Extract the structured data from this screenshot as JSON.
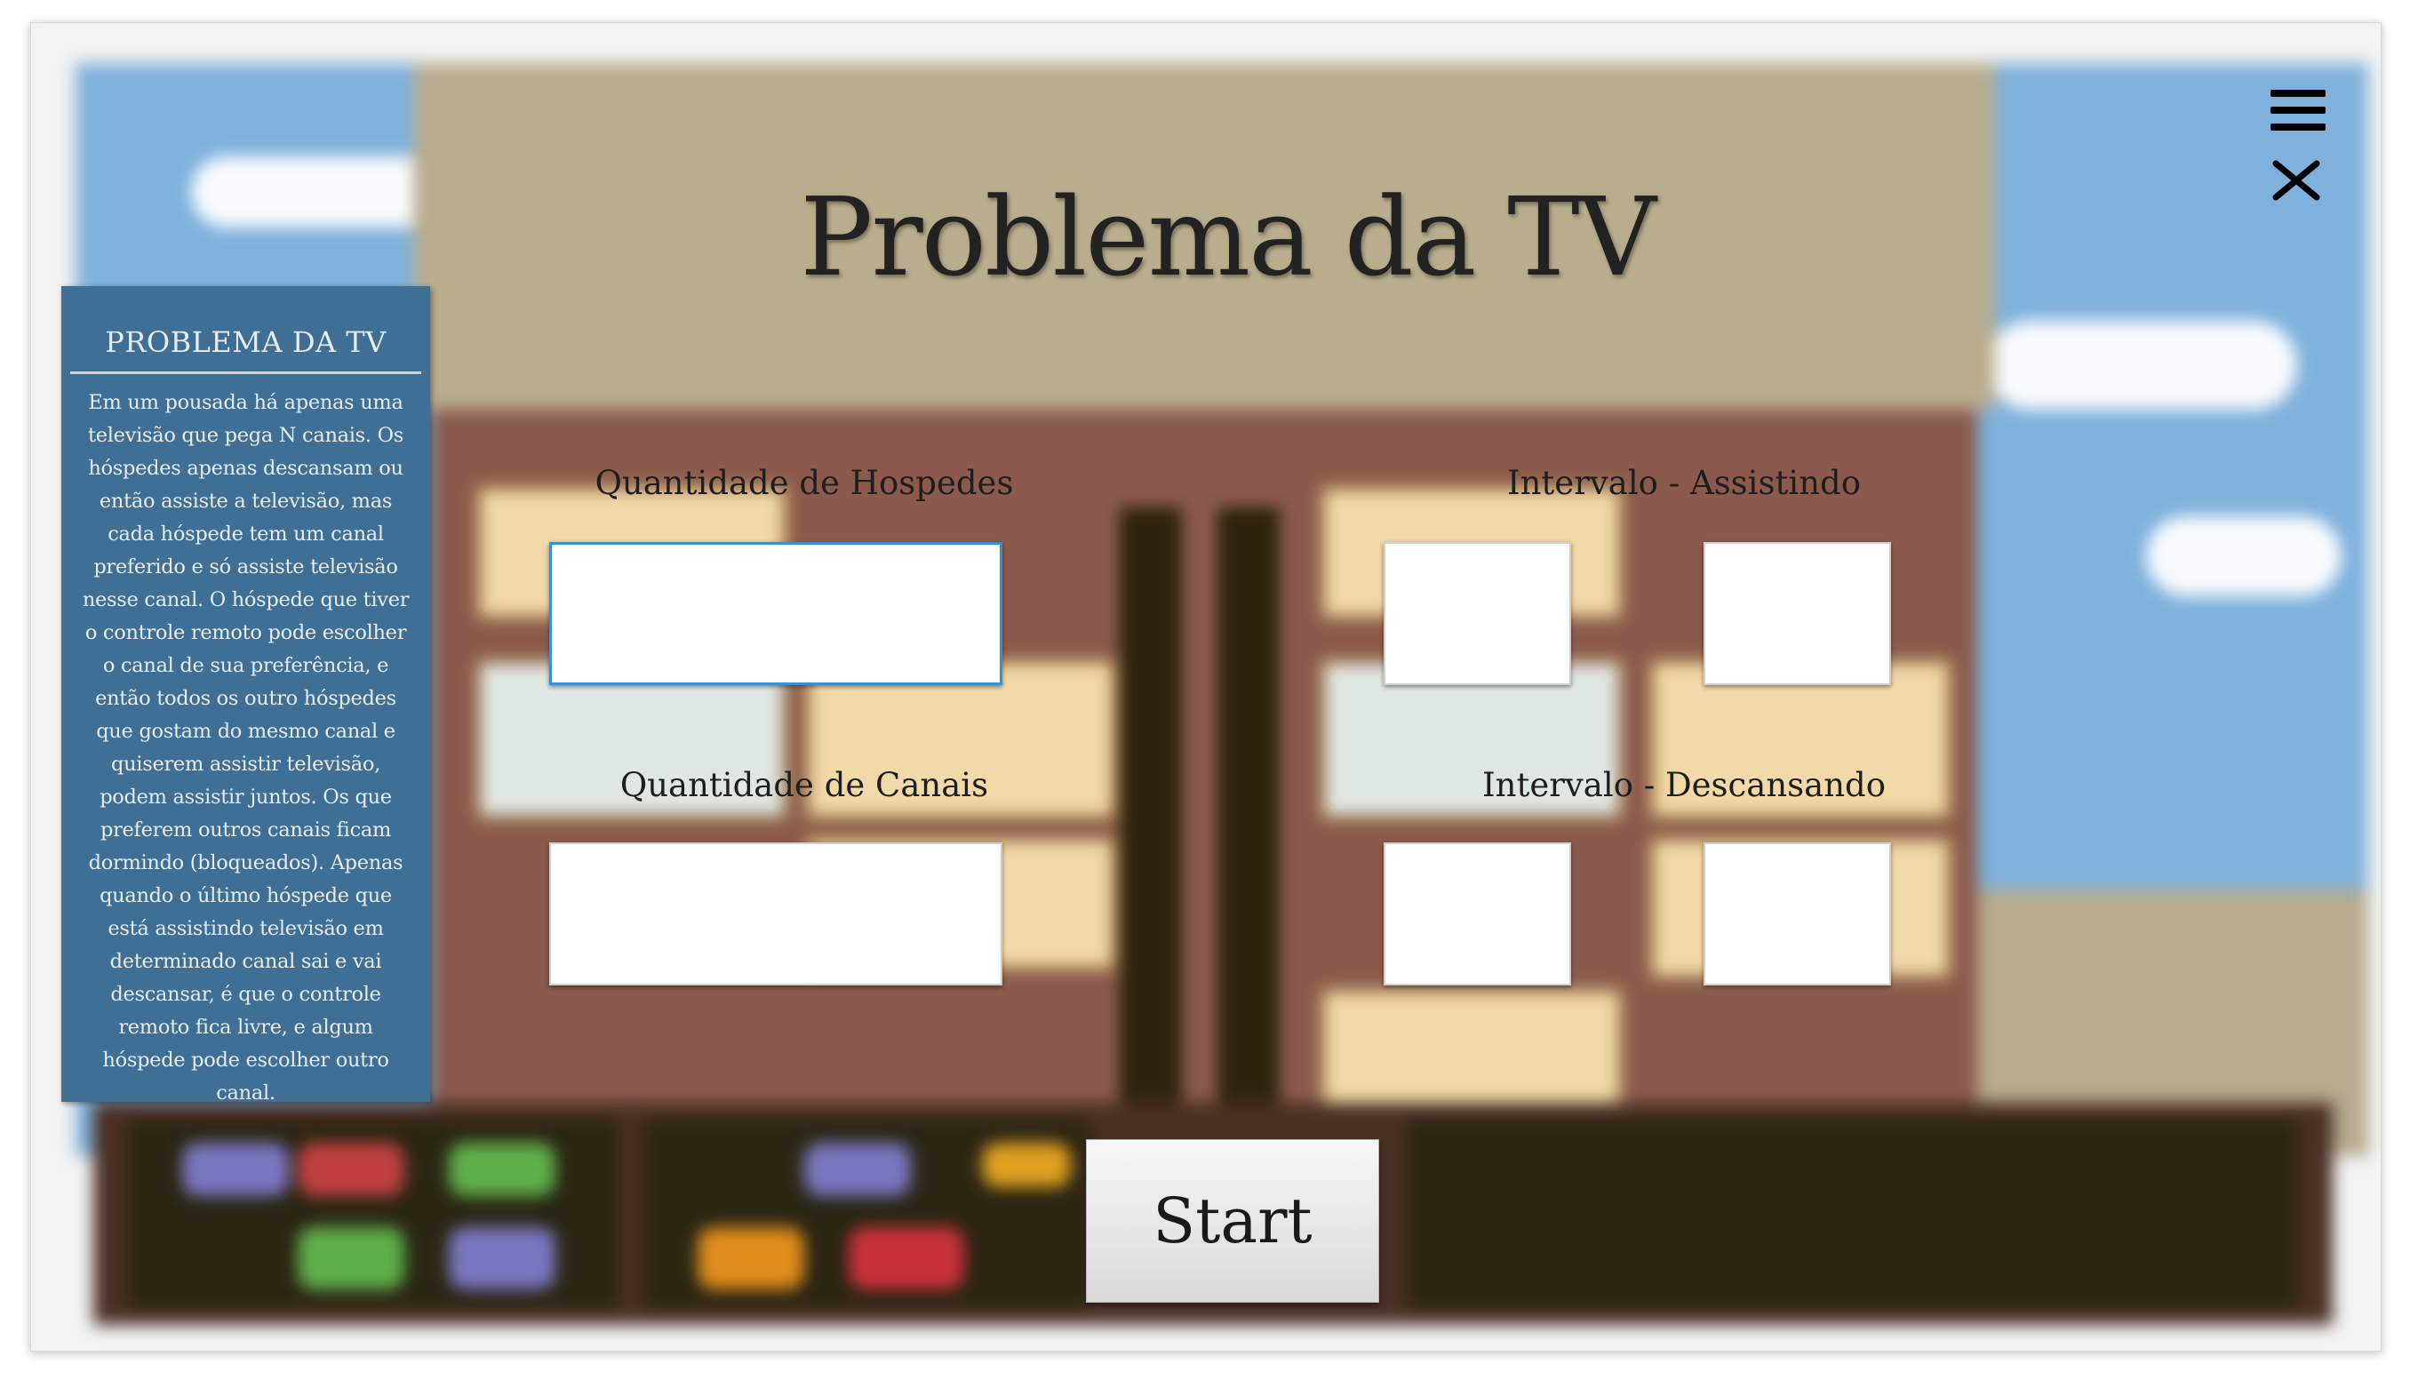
{
  "app": {
    "title": "Problema da TV"
  },
  "sidebar": {
    "title": "PROBLEMA DA TV",
    "description": "Em um pousada há apenas uma televisão que pega N canais. Os hóspedes apenas descansam ou então assiste a televisão, mas cada hóspede tem um canal preferido e só assiste televisão nesse canal. O hóspede que tiver o controle remoto pode escolher o canal de sua preferência, e então todos os outro hóspedes que gostam do mesmo canal e quiserem assistir televisão, podem assistir juntos. Os que preferem outros canais ficam dormindo (bloqueados). Apenas quando o último hóspede que está assistindo televisão em determinado canal sai e vai descansar, é que o controle remoto fica livre, e algum hóspede pode escolher outro canal."
  },
  "form": {
    "guests_label": "Quantidade de Hospedes",
    "guests_value": "",
    "channels_label": "Quantidade de Canais",
    "channels_value": "",
    "watching_label": "Intervalo - Assistindo",
    "watching_min": "",
    "watching_max": "",
    "resting_label": "Intervalo - Descansando",
    "resting_min": "",
    "resting_max": "",
    "start_label": "Start"
  },
  "icons": {
    "menu": "hamburger-menu-icon",
    "close": "close-icon"
  },
  "colors": {
    "sidebar_bg": "#3f6f95",
    "building_top": "#b8ad8d",
    "building_body": "#8b5a4c",
    "sky": "#7eb1dc",
    "focus_border": "#3b8fd9"
  }
}
